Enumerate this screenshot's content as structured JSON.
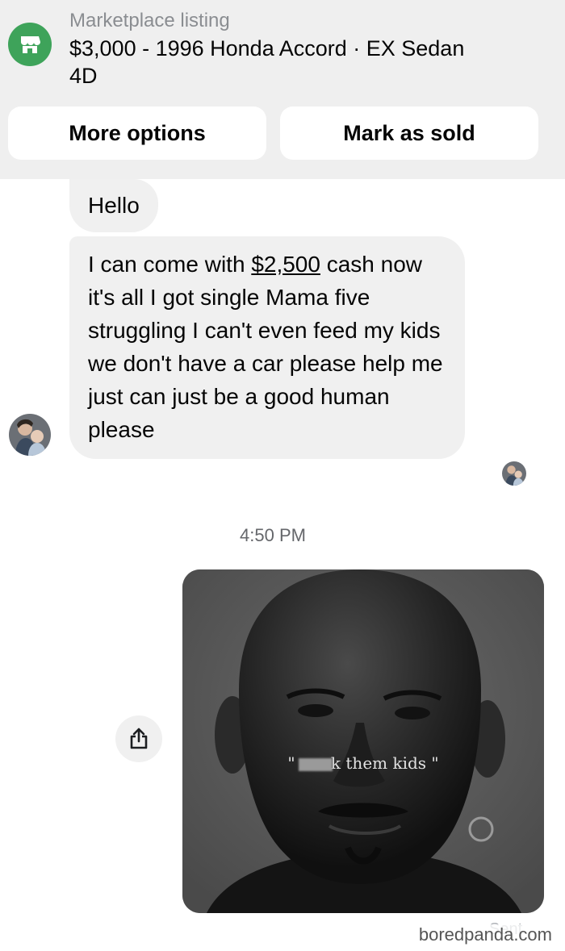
{
  "listing": {
    "label": "Marketplace listing",
    "title": "$3,000 - 1996 Honda Accord · EX Sedan 4D",
    "icon": "storefront-icon",
    "icon_color": "#3ea35a"
  },
  "actions": {
    "more_options": "More options",
    "mark_as_sold": "Mark as sold"
  },
  "messages": {
    "hello": "Hello",
    "long_before": "I can come with ",
    "long_amount": "$2,500",
    "long_after": " cash now it's all I got single Mama five struggling I can't even feed my kids we don't have a car please help me just can just be a good human please"
  },
  "timestamp": "4:50 PM",
  "image_caption": {
    "open_quote": "\"",
    "text": "k them kids \""
  },
  "status": "Sent",
  "watermark": "boredpanda.com",
  "colors": {
    "header_bg": "#efefef",
    "bubble_bg": "#f0f0f0",
    "secondary_text": "#65676b"
  }
}
